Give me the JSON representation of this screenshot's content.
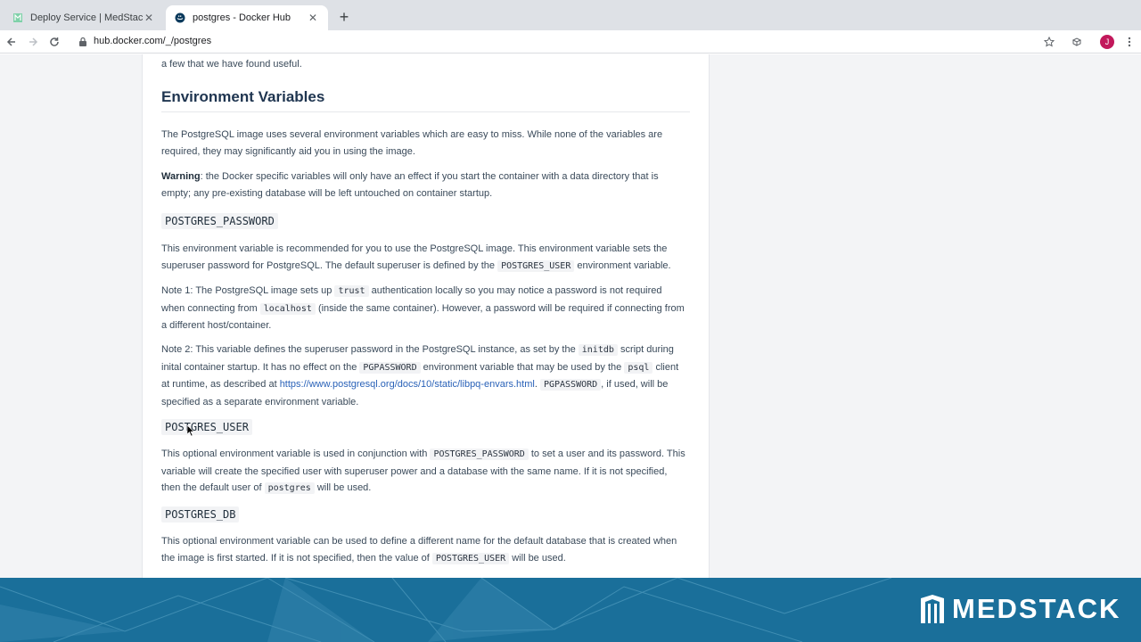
{
  "browser": {
    "tabs": [
      {
        "title": "Deploy Service | MedStack",
        "active": false
      },
      {
        "title": "postgres - Docker Hub",
        "active": true
      }
    ],
    "url": "hub.docker.com/_/postgres",
    "avatar_letter": "J"
  },
  "doc": {
    "intro_tail": "a few that we have found useful.",
    "heading": "Environment Variables",
    "p1": "The PostgreSQL image uses several environment variables which are easy to miss. While none of the variables are required, they may significantly aid you in using the image.",
    "warning_label": "Warning",
    "warning_text": ": the Docker specific variables will only have an effect if you start the container with a data directory that is empty; any pre-existing database will be left untouched on container startup.",
    "var1": "POSTGRES_PASSWORD",
    "var1_p1_a": "This environment variable is recommended for you to use the PostgreSQL image. This environment variable sets the superuser password for PostgreSQL. The default superuser is defined by the",
    "var1_p1_code": "POSTGRES_USER",
    "var1_p1_b": "environment variable.",
    "note1_a": "Note 1: The PostgreSQL image sets up",
    "note1_code1": "trust",
    "note1_b": "authentication locally so you may notice a password is not required when connecting from",
    "note1_code2": "localhost",
    "note1_c": "(inside the same container). However, a password will be required if connecting from a different host/container.",
    "note2_a": "Note 2: This variable defines the superuser password in the PostgreSQL instance, as set by the",
    "note2_code1": "initdb",
    "note2_b": "script during inital container startup. It has no effect on the",
    "note2_code2": "PGPASSWORD",
    "note2_c": "environment variable that may be used by the",
    "note2_code3": "psql",
    "note2_d": "client at runtime, as described at",
    "note2_link": "https://www.postgresql.org/docs/10/static/libpq-envars.html",
    "note2_e": ".",
    "note2_code4": "PGPASSWORD",
    "note2_f": ", if used, will be specified as a separate environment variable.",
    "var2": "POSTGRES_USER",
    "var2_p_a": "This optional environment variable is used in conjunction with",
    "var2_p_code1": "POSTGRES_PASSWORD",
    "var2_p_b": "to set a user and its password. This variable will create the specified user with superuser power and a database with the same name. If it is not specified, then the default user of",
    "var2_p_code2": "postgres",
    "var2_p_c": "will be used.",
    "var3": "POSTGRES_DB",
    "var3_p_a": "This optional environment variable can be used to define a different name for the default database that is created when the image is first started. If it is not specified, then the value of",
    "var3_p_code": "POSTGRES_USER",
    "var3_p_b": "will be used."
  },
  "banner": {
    "brand": "MEDSTACK",
    "background_color": "#1a6f9a"
  },
  "icons": {
    "back": "arrow-left-icon",
    "forward": "arrow-right-icon",
    "reload": "reload-icon",
    "lock": "lock-icon",
    "star": "star-icon",
    "extension": "extension-icon",
    "menu": "kebab-menu-icon"
  }
}
